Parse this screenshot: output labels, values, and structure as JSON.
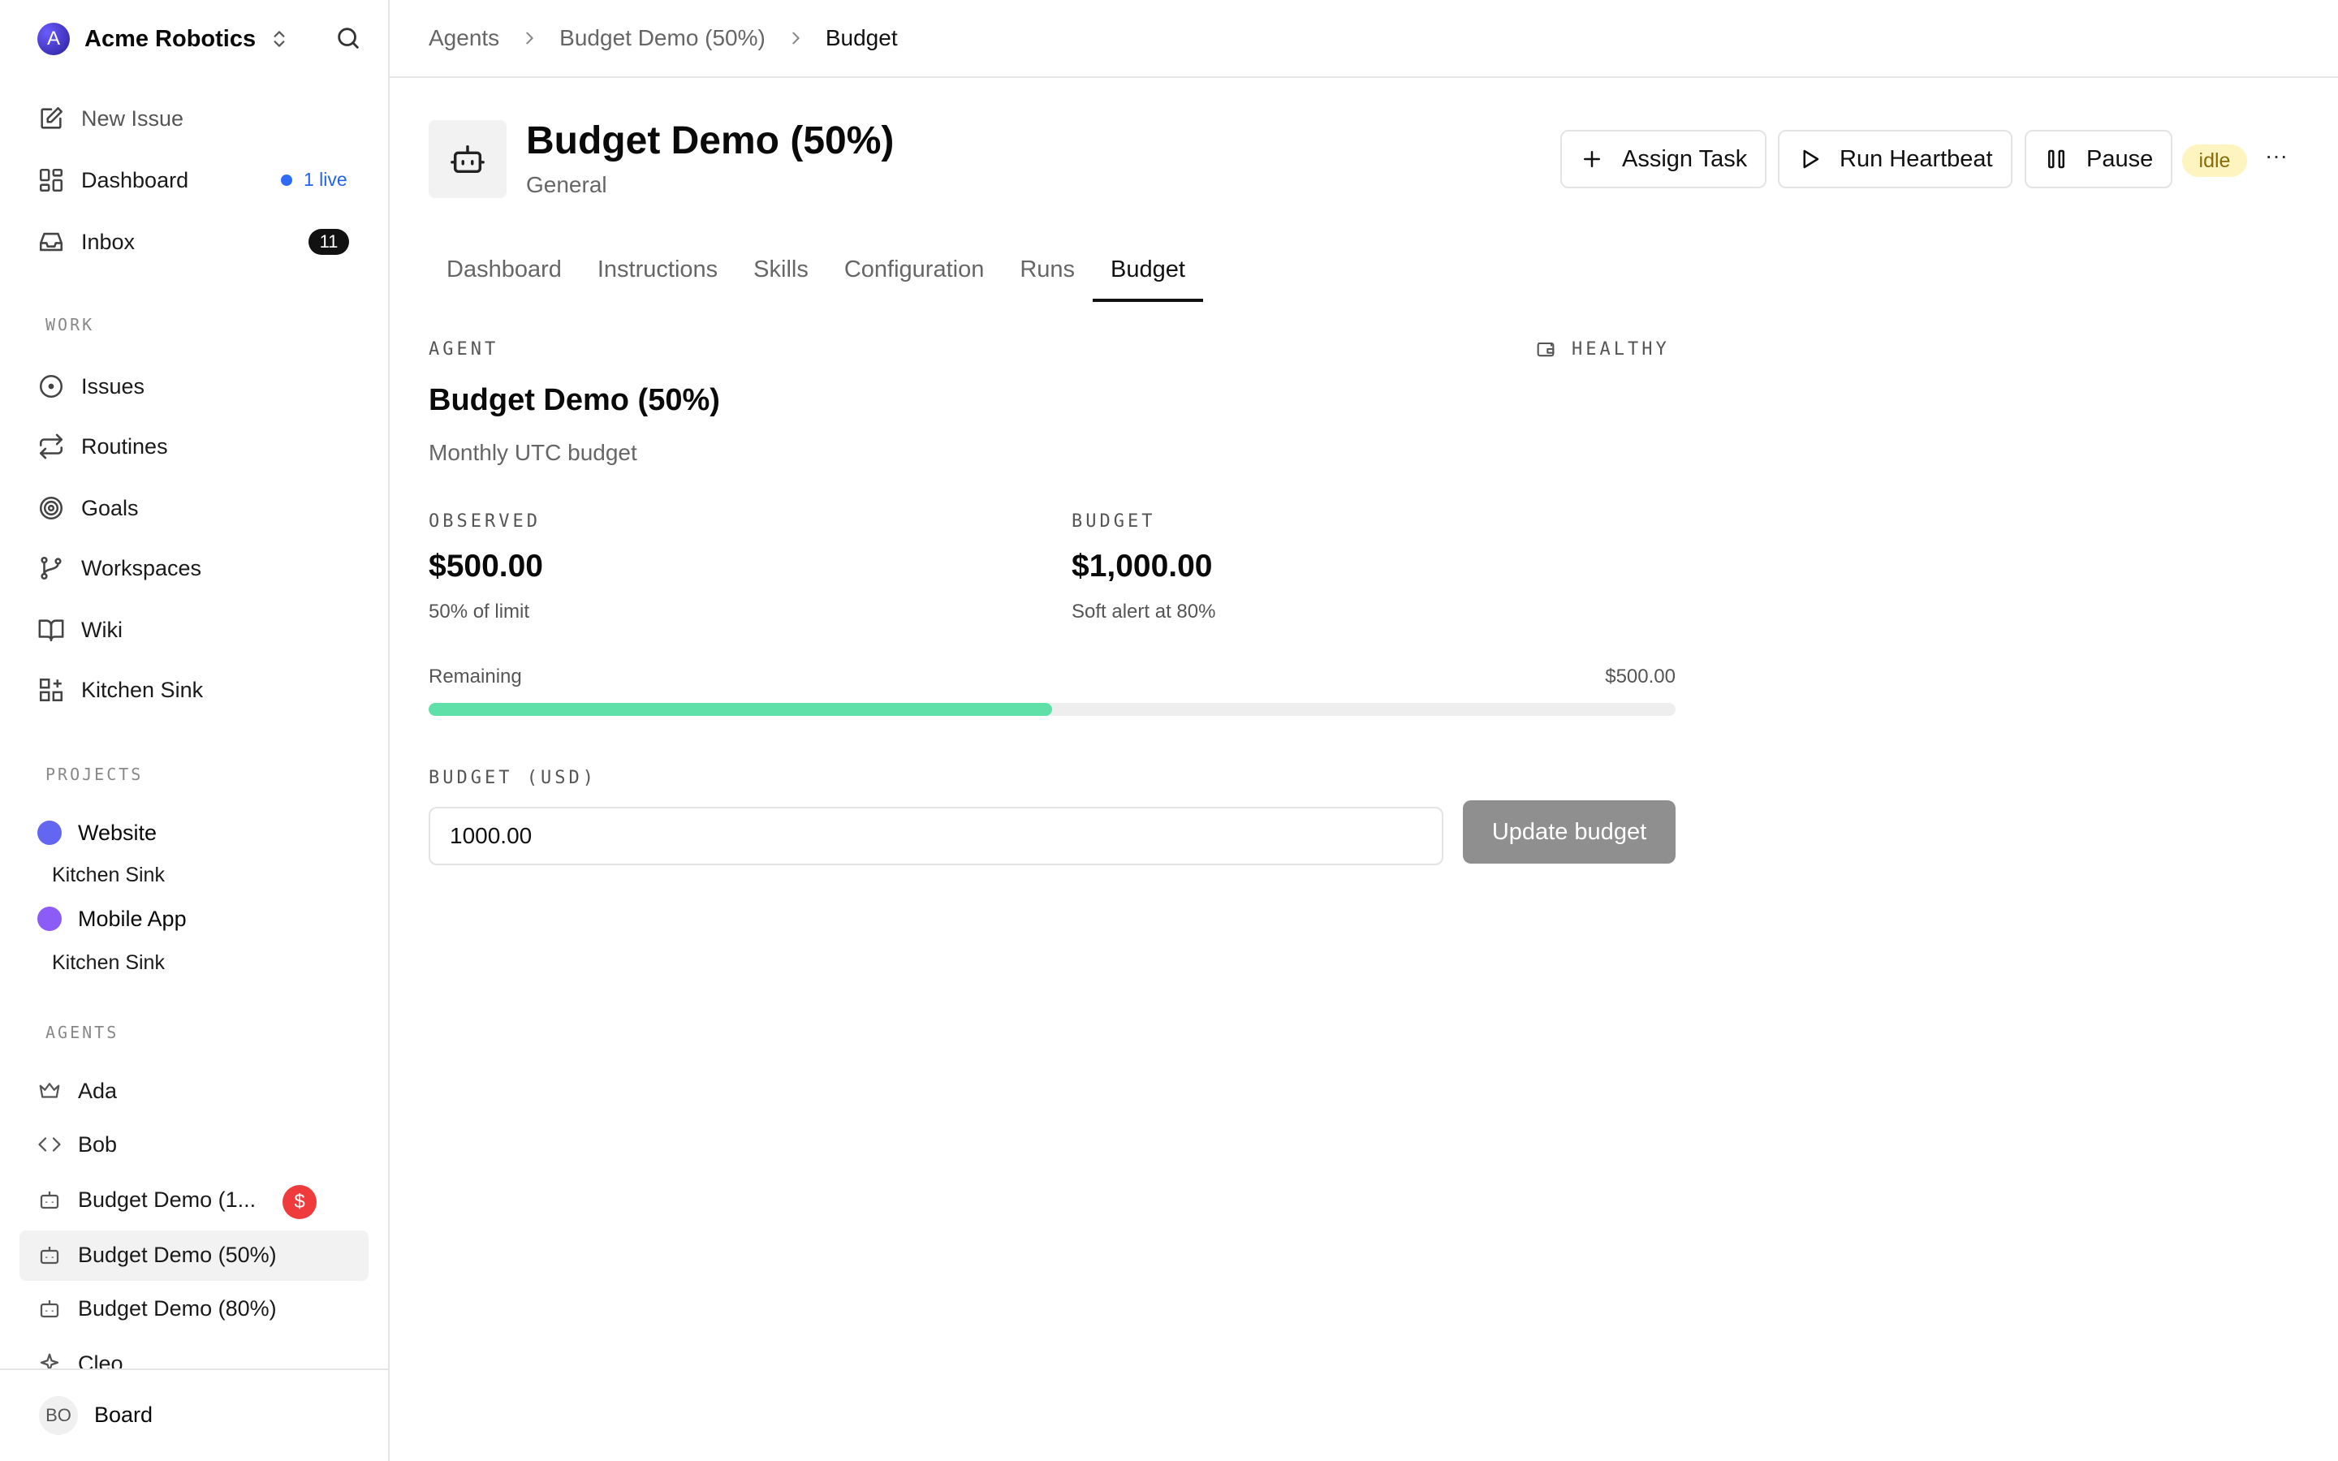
{
  "sidebar": {
    "workspace": {
      "initial": "A",
      "name": "Acme Robotics"
    },
    "nav": [
      {
        "label": "New Issue",
        "icon": "edit-icon"
      },
      {
        "label": "Dashboard",
        "icon": "dashboard-icon"
      },
      {
        "label": "Inbox",
        "icon": "inbox-icon"
      }
    ],
    "live_label": "1 live",
    "inbox_count": "11",
    "work_label": "WORK",
    "work": [
      {
        "label": "Issues",
        "icon": "circle-dot-icon"
      },
      {
        "label": "Routines",
        "icon": "repeat-icon"
      },
      {
        "label": "Goals",
        "icon": "target-icon"
      },
      {
        "label": "Workspaces",
        "icon": "git-branch-icon"
      },
      {
        "label": "Wiki",
        "icon": "book-icon"
      },
      {
        "label": "Kitchen Sink",
        "icon": "grid-plus-icon"
      }
    ],
    "projects_label": "PROJECTS",
    "projects": [
      {
        "name": "Website",
        "color": "#6366f1",
        "sub": "Kitchen Sink"
      },
      {
        "name": "Mobile App",
        "color": "#8b5cf6",
        "sub": "Kitchen Sink"
      }
    ],
    "agents_label": "AGENTS",
    "agents": [
      {
        "name": "Ada",
        "icon": "crown-icon"
      },
      {
        "name": "Bob",
        "icon": "code-icon"
      },
      {
        "name": "Budget Demo (1...",
        "icon": "bot-icon"
      },
      {
        "name": "Budget Demo (50%)",
        "icon": "bot-icon"
      },
      {
        "name": "Budget Demo (80%)",
        "icon": "bot-icon"
      },
      {
        "name": "Cleo",
        "icon": "sparkle-icon"
      }
    ],
    "agent_warn_symbol": "$",
    "footer": {
      "initials": "BO",
      "label": "Board"
    }
  },
  "breadcrumb": [
    "Agents",
    "Budget Demo (50%)",
    "Budget"
  ],
  "header": {
    "title": "Budget Demo (50%)",
    "subtitle": "General",
    "assign_label": "Assign Task",
    "heartbeat_label": "Run Heartbeat",
    "pause_label": "Pause",
    "status": "idle",
    "more": "···"
  },
  "tabs": [
    "Dashboard",
    "Instructions",
    "Skills",
    "Configuration",
    "Runs",
    "Budget"
  ],
  "budget": {
    "scope_label": "AGENT",
    "health": "HEALTHY",
    "name": "Budget Demo (50%)",
    "period": "Monthly UTC budget",
    "observed_label": "OBSERVED",
    "observed": "$500.00",
    "observed_note": "50% of limit",
    "budget_label": "BUDGET",
    "budget": "$1,000.00",
    "budget_note": "Soft alert at 80%",
    "remaining_label": "Remaining",
    "remaining": "$500.00",
    "used_fraction": 0.5,
    "input_label": "BUDGET (USD)",
    "input_value": "1000.00",
    "update_label": "Update budget"
  }
}
